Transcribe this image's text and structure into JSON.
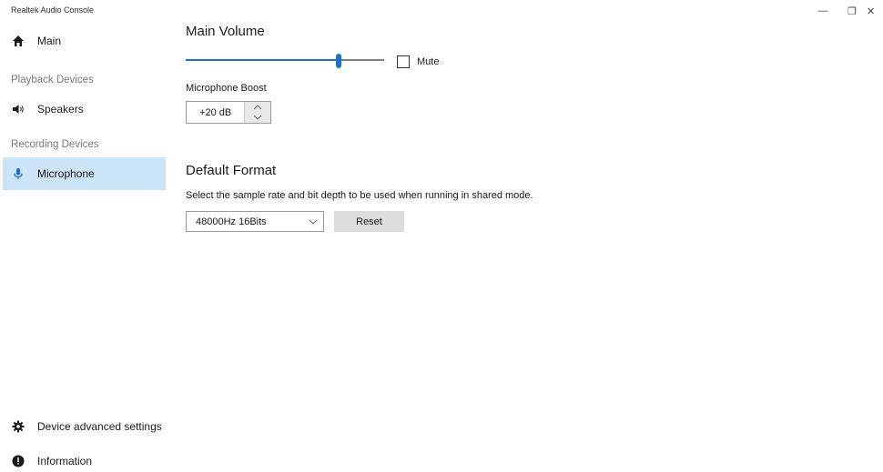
{
  "window": {
    "title": "Realtek Audio Console",
    "controls": {
      "minimize": "—",
      "restore": "❐",
      "close": "✕"
    }
  },
  "sidebar": {
    "main_label": "Main",
    "playback_header": "Playback Devices",
    "speakers_label": "Speakers",
    "recording_header": "Recording Devices",
    "microphone_label": "Microphone",
    "advanced_label": "Device advanced settings",
    "information_label": "Information",
    "selected": "Microphone"
  },
  "main": {
    "volume_title": "Main Volume",
    "volume_level_fraction": 0.78,
    "mute_label": "Mute",
    "mute_checked": false,
    "boost_label": "Microphone Boost",
    "boost_value": "+20 dB",
    "format_title": "Default Format",
    "format_desc": "Select the sample rate and bit depth to be used when running in shared mode.",
    "format_value": "48000Hz 16Bits",
    "reset_label": "Reset"
  },
  "colors": {
    "accent": "#1a73c8",
    "selected_bg": "#cce4f7",
    "button_bg": "#dcdcdc"
  }
}
